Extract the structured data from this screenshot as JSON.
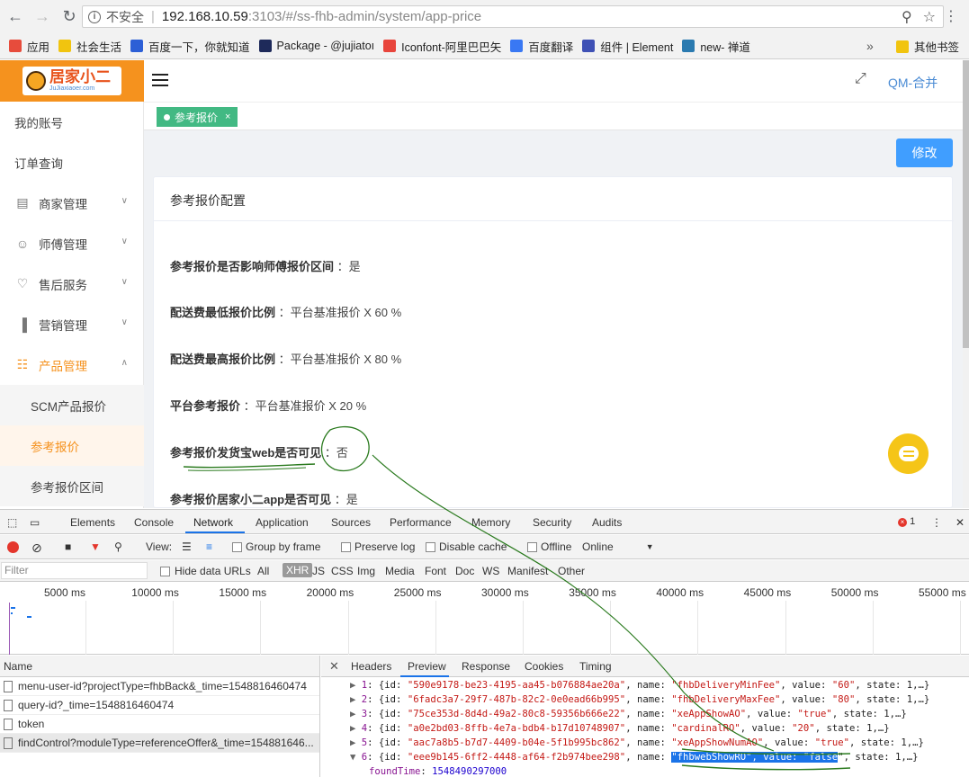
{
  "browser": {
    "insecure_label": "不安全",
    "url_host": "192.168.10.59",
    "url_path": ":3103/#/ss-fhb-admin/system/app-price",
    "bookmarks": [
      {
        "label": "应用",
        "color": "#e74c3c"
      },
      {
        "label": "社会生活",
        "color": "#f1c40f"
      },
      {
        "label": "百度一下，你就知道",
        "color": "#2c5fd6"
      },
      {
        "label": "Package - @jujiatoı",
        "color": "#1e2a5a"
      },
      {
        "label": "Iconfont-阿里巴巴矢",
        "color": "#e8453c"
      },
      {
        "label": "百度翻译",
        "color": "#3978f3"
      },
      {
        "label": "组件 | Element",
        "color": "#3f51b5"
      },
      {
        "label": "new- 禅道",
        "color": "#2a7ab0"
      }
    ],
    "bookmarks_more": "»",
    "other_bookmarks": "其他书签"
  },
  "app": {
    "logo_text": "居家小二",
    "logo_sub": "JuJiaxiaoer.com",
    "user_name": "QM-合并",
    "sidebar": [
      {
        "label": "我的账号",
        "icon": ""
      },
      {
        "label": "订单查询",
        "icon": ""
      },
      {
        "label": "商家管理",
        "icon": "shop-icon",
        "chev": true
      },
      {
        "label": "师傅管理",
        "icon": "user-icon",
        "chev": true
      },
      {
        "label": "售后服务",
        "icon": "service-icon",
        "chev": true
      },
      {
        "label": "营销管理",
        "icon": "chart-icon",
        "chev": true
      },
      {
        "label": "产品管理",
        "icon": "grid-icon",
        "chev": true,
        "open": true
      },
      {
        "label": "SCM产品报价",
        "sub": true
      },
      {
        "label": "参考报价",
        "sub": true,
        "active": true
      },
      {
        "label": "参考报价区间",
        "sub": true
      }
    ],
    "tab_label": "参考报价",
    "tab_close": "×",
    "edit_button": "修改",
    "card_title": "参考报价配置",
    "rows": [
      {
        "label": "参考报价是否影响师傅报价区间",
        "value": "：是"
      },
      {
        "label": "配送费最低报价比例",
        "value": "：平台基准报价 X 60 %"
      },
      {
        "label": "配送费最高报价比例",
        "value": "：平台基准报价 X 80 %"
      },
      {
        "label": "平台参考报价",
        "value": "：平台基准报价 X 20 %"
      },
      {
        "label": "参考报价发货宝web是否可见",
        "value": "：否"
      },
      {
        "label": "参考报价居家小二app是否可见",
        "value": "：是"
      }
    ]
  },
  "devtools": {
    "tabs": [
      "Elements",
      "Console",
      "Network",
      "Application",
      "Sources",
      "Performance",
      "Memory",
      "Security",
      "Audits"
    ],
    "active_tab": "Network",
    "error_count": "1",
    "toolbar": {
      "view": "View:",
      "group_by_frame": "Group by frame",
      "preserve_log": "Preserve log",
      "disable_cache": "Disable cache",
      "offline": "Offline",
      "online": "Online"
    },
    "filter_placeholder": "Filter",
    "filter_types": [
      "Hide data URLs",
      "All",
      "XHR",
      "JS",
      "CSS",
      "Img",
      "Media",
      "Font",
      "Doc",
      "WS",
      "Manifest",
      "Other"
    ],
    "selected_type": "XHR",
    "timeline_labels": [
      "5000 ms",
      "10000 ms",
      "15000 ms",
      "20000 ms",
      "25000 ms",
      "30000 ms",
      "35000 ms",
      "40000 ms",
      "45000 ms",
      "50000 ms",
      "55000 ms"
    ],
    "name_header": "Name",
    "requests": [
      "menu-user-id?projectType=fhbBack&_time=1548816460474",
      "query-id?_time=1548816460474",
      "token",
      "findControl?moduleType=referenceOffer&_time=154881646..."
    ],
    "detail_tabs": [
      "Headers",
      "Preview",
      "Response",
      "Cookies",
      "Timing"
    ],
    "active_detail_tab": "Preview",
    "preview_lines": [
      {
        "idx": "1",
        "id": "590e9178-be23-4195-aa45-b076884ae20a",
        "name": "fhbDeliveryMinFee",
        "value": "60"
      },
      {
        "idx": "2",
        "id": "6fadc3a7-29f7-487b-82c2-0e0ead66b995",
        "name": "fhbDeliveryMaxFee",
        "value": "80"
      },
      {
        "idx": "3",
        "id": "75ce353d-8d4d-49a2-80c8-59356b666e22",
        "name": "xeAppShowAO",
        "value": "true"
      },
      {
        "idx": "4",
        "id": "a0e2bd03-8ffb-4e7a-bdb4-b17d10748907",
        "name": "cardinalRO",
        "value": "20"
      },
      {
        "idx": "5",
        "id": "aac7a8b5-b7d7-4409-b04e-5f1b995bc862",
        "name": "xeAppShowNumAO",
        "value": "true"
      },
      {
        "idx": "6",
        "id": "eee9b145-6ff2-4448-af64-f2b974bee298",
        "name": "fhbwebShowRO",
        "value": "false",
        "expanded": true
      }
    ],
    "found_time_key": "foundTime",
    "found_time_value": "1548490297000"
  }
}
